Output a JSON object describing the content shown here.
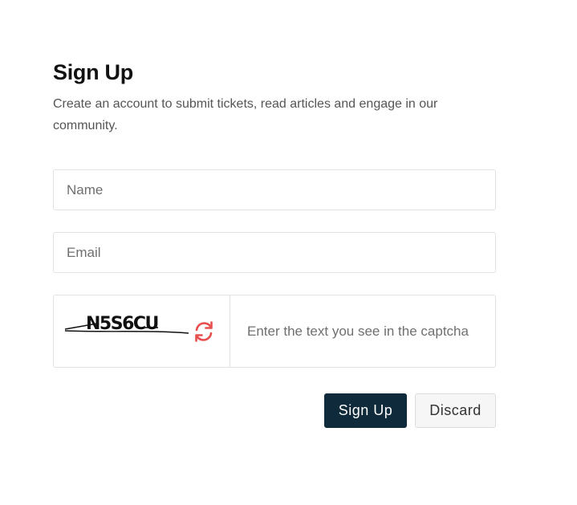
{
  "form": {
    "title": "Sign Up",
    "subtitle": "Create an account to submit tickets, read articles and engage in our community."
  },
  "fields": {
    "name_placeholder": "Name",
    "name_value": "",
    "email_placeholder": "Email",
    "email_value": "",
    "captcha_placeholder": "Enter the text you see in the captcha",
    "captcha_value": ""
  },
  "captcha": {
    "text": "N5S6CU",
    "refresh_icon": "refresh-icon",
    "refresh_color": "#e8504f"
  },
  "buttons": {
    "signup_label": "Sign Up",
    "discard_label": "Discard"
  },
  "colors": {
    "primary": "#0f2a3a",
    "border": "#e2e2e2"
  }
}
